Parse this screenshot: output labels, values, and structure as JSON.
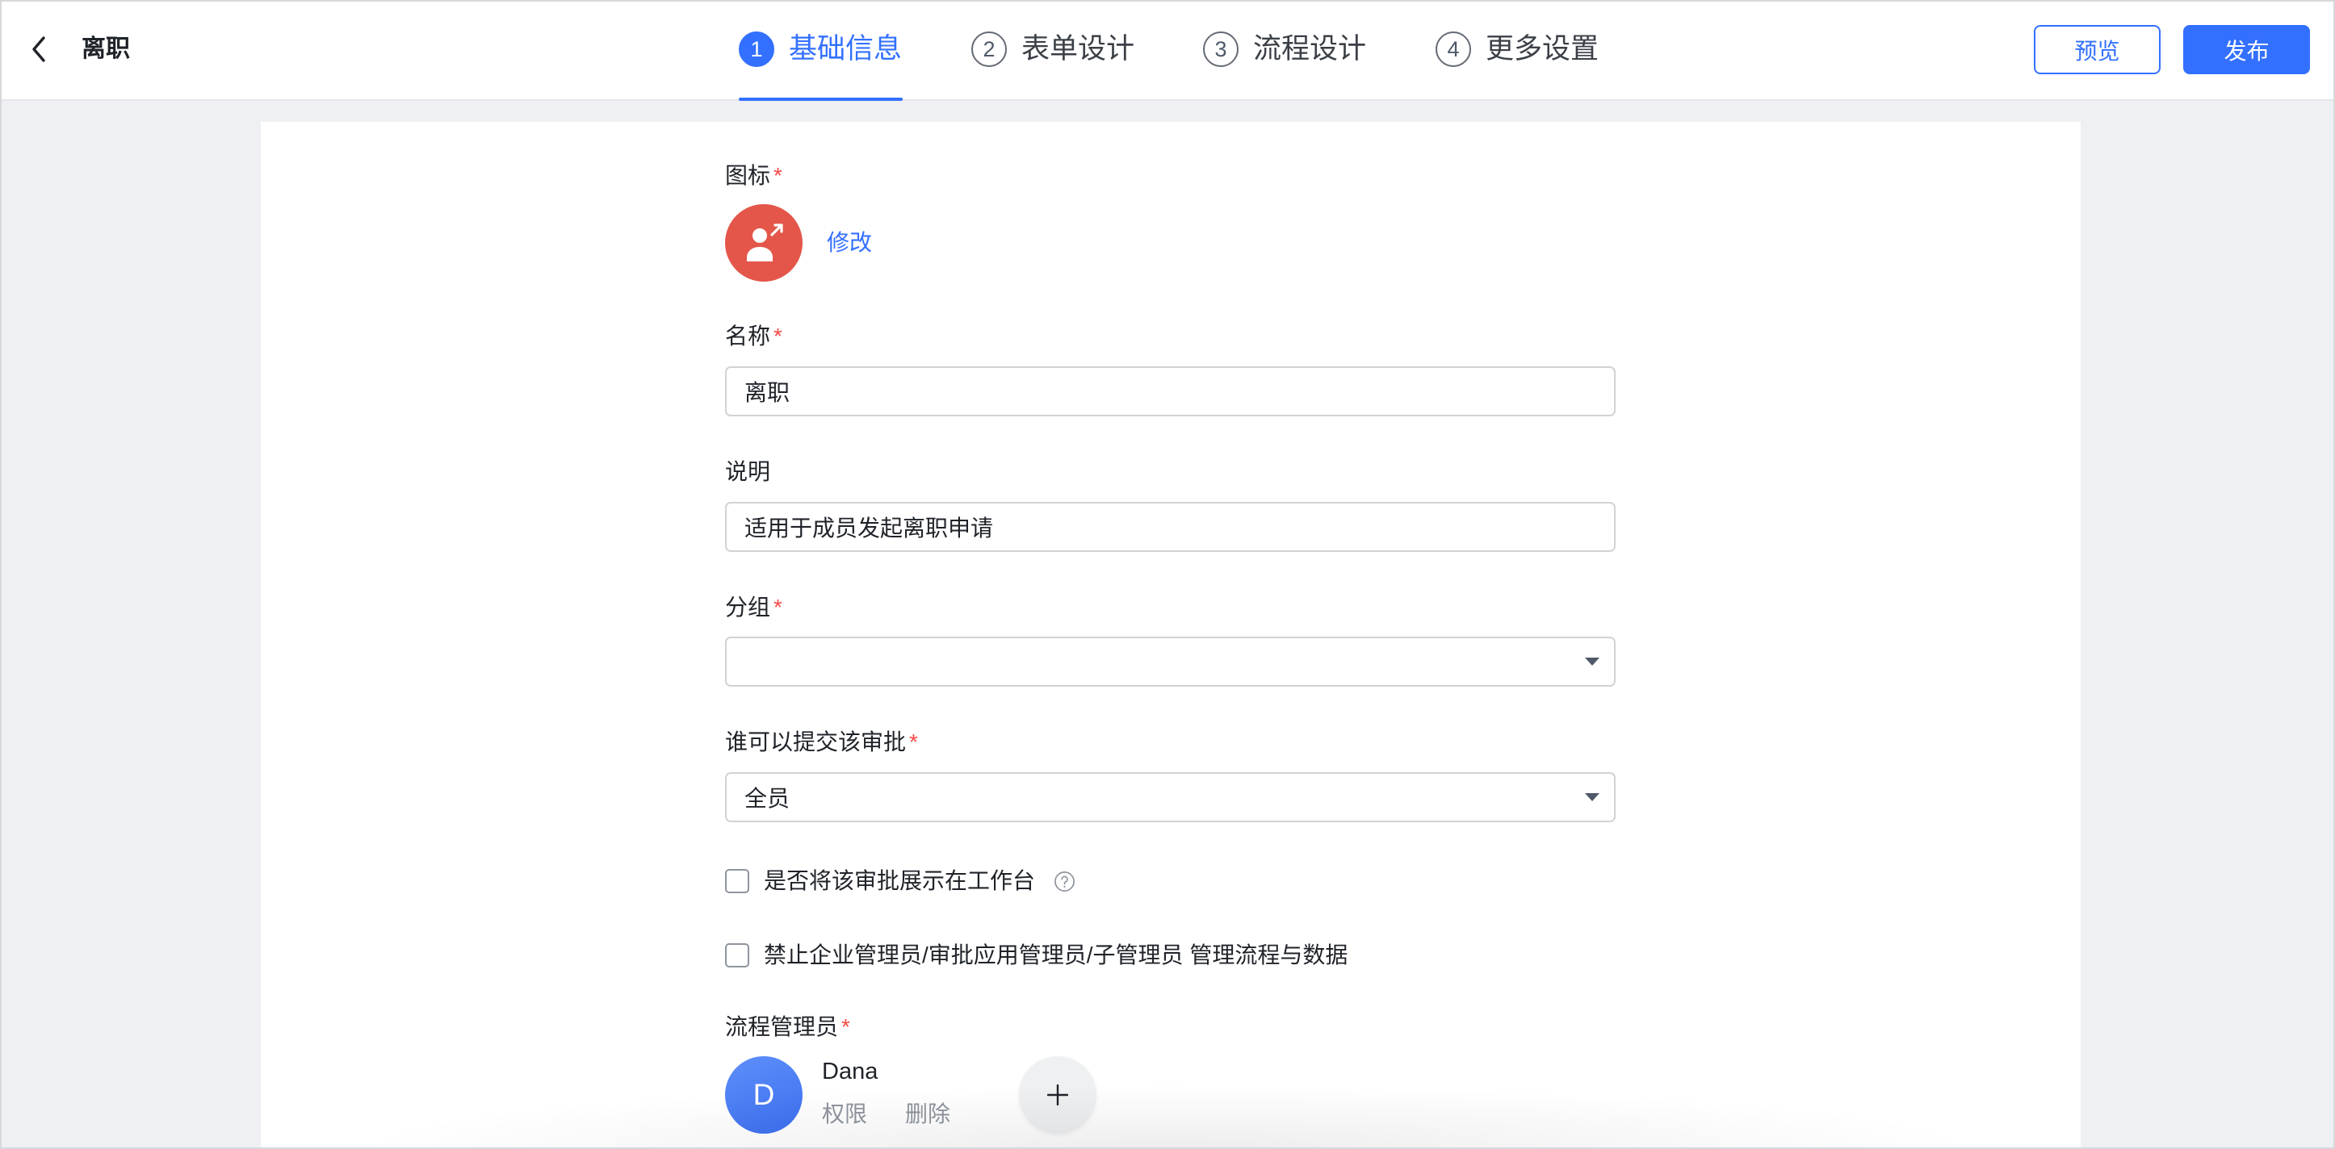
{
  "header": {
    "back_icon": "chevron-left-icon",
    "title": "离职",
    "steps": [
      {
        "number": "1",
        "label": "基础信息",
        "active": true
      },
      {
        "number": "2",
        "label": "表单设计",
        "active": false
      },
      {
        "number": "3",
        "label": "流程设计",
        "active": false
      },
      {
        "number": "4",
        "label": "更多设置",
        "active": false
      }
    ],
    "preview_button": "预览",
    "publish_button": "发布"
  },
  "form": {
    "required_mark": "*",
    "icon_field": {
      "label": "图标",
      "required": true,
      "icon": "person-leave-icon",
      "edit_link": "修改"
    },
    "name_field": {
      "label": "名称",
      "required": true,
      "value": "离职"
    },
    "description_field": {
      "label": "说明",
      "required": false,
      "value": "适用于成员发起离职申请"
    },
    "group_field": {
      "label": "分组",
      "required": true,
      "value": "",
      "dropdown_icon": "caret-down-icon"
    },
    "submitter_field": {
      "label": "谁可以提交该审批",
      "required": true,
      "value": "全员",
      "dropdown_icon": "caret-down-icon"
    },
    "show_in_workbench": {
      "label": "是否将该审批展示在工作台",
      "checked": false,
      "help_icon": "question-circle-icon"
    },
    "forbid_admin_manage": {
      "label": "禁止企业管理员/审批应用管理员/子管理员 管理流程与数据",
      "checked": false
    },
    "process_admins": {
      "label": "流程管理员",
      "required": true,
      "admins": [
        {
          "initial": "D",
          "name": "Dana",
          "permission_link": "权限",
          "delete_link": "删除"
        }
      ],
      "add_icon": "plus-icon"
    }
  },
  "colors": {
    "accent": "#3370ff",
    "required": "#f54a45",
    "icon_red": "#e4564a",
    "avatar_blue": "#3c6ef0",
    "page_background": "#eef0f3",
    "muted_text": "#8f959e"
  }
}
